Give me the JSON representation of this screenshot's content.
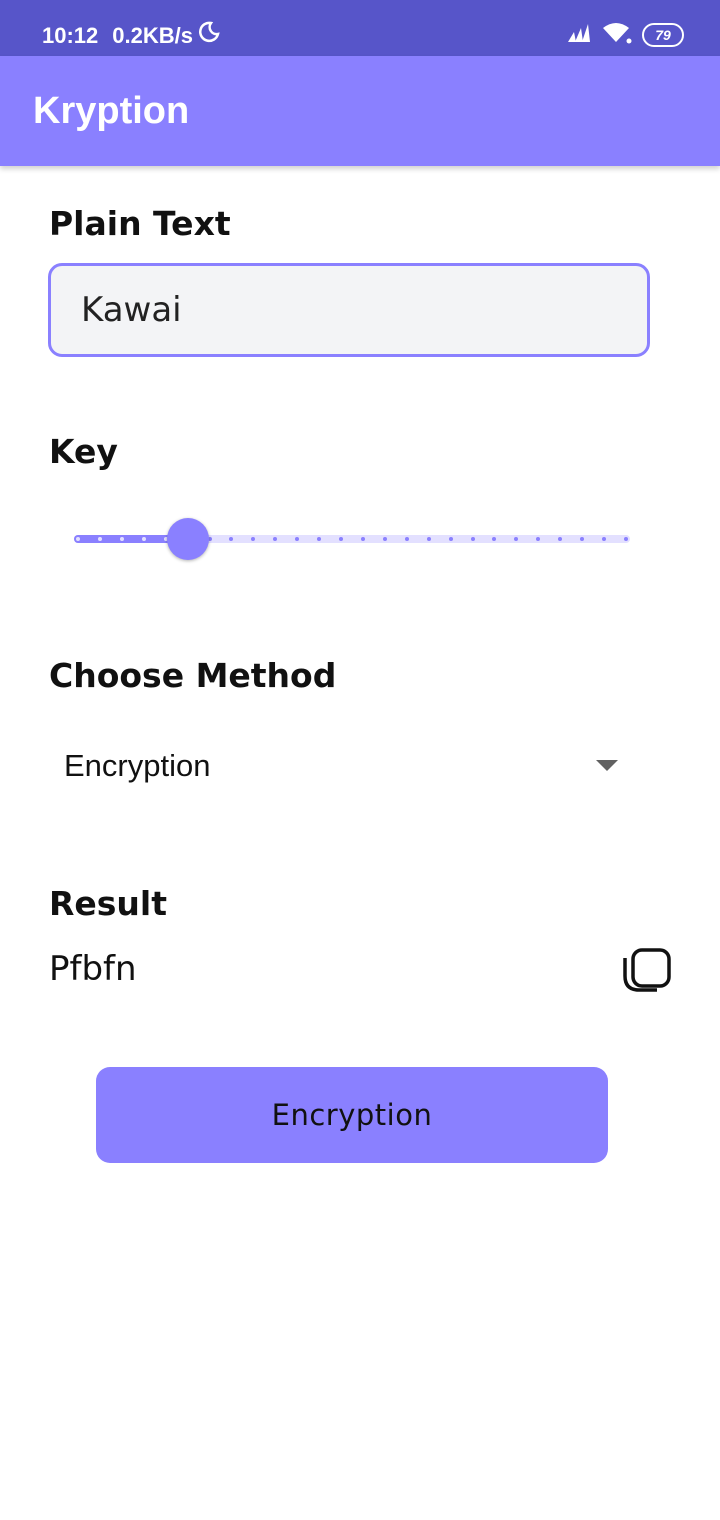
{
  "status_bar": {
    "time": "10:12",
    "speed": "0.2KB/s",
    "battery": "79",
    "icons": [
      "moon-icon",
      "signal-icon",
      "wifi-icon",
      "battery-icon"
    ],
    "color": "#5755c9"
  },
  "app_bar": {
    "title": "Kryption",
    "color": "#8a80ff"
  },
  "form": {
    "plain_text": {
      "label": "Plain Text",
      "value": "Kawai",
      "placeholder": ""
    },
    "key": {
      "label": "Key",
      "value": 5,
      "min": 0,
      "max": 25
    },
    "method": {
      "label": "Choose Method",
      "selected": "Encryption"
    },
    "result": {
      "label": "Result",
      "value": "Pfbfn",
      "copy_icon": "copy-icon"
    },
    "submit_label": "Encryption"
  },
  "colors": {
    "accent": "#8a80ff",
    "accent_light": "#e3e0ff",
    "input_bg": "#f3f4f6"
  }
}
